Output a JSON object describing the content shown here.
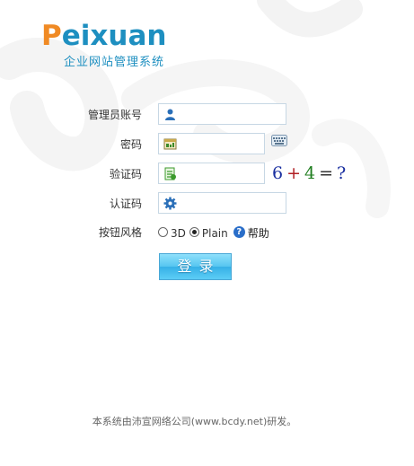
{
  "logo": {
    "brand_first": "P",
    "brand_rest": "eixuan",
    "subtitle": "企业网站管理系统"
  },
  "form": {
    "account": {
      "label": "管理员账号",
      "value": "",
      "icon": "user-icon"
    },
    "password": {
      "label": "密码",
      "value": "",
      "icon": "password-icon",
      "keyboard_icon": "keyboard-icon"
    },
    "verify": {
      "label": "验证码",
      "value": "",
      "icon": "verify-code-icon",
      "captcha": {
        "a": "6",
        "op": "+",
        "b": "4",
        "eq": "=",
        "q": "?"
      }
    },
    "auth": {
      "label": "认证码",
      "value": "",
      "icon": "gear-icon"
    },
    "button_style": {
      "label": "按钮风格",
      "options": [
        "3D",
        "Plain"
      ],
      "selected": "Plain",
      "help_label": "帮助"
    },
    "login_label": "登录"
  },
  "footer": {
    "text": "本系统由沛宣网络公司(www.bcdy.net)研发。"
  },
  "colors": {
    "brand_orange": "#f08a24",
    "brand_blue": "#1e8fc0",
    "button_blue": "#36b0e6",
    "border": "#c7d7e4"
  }
}
